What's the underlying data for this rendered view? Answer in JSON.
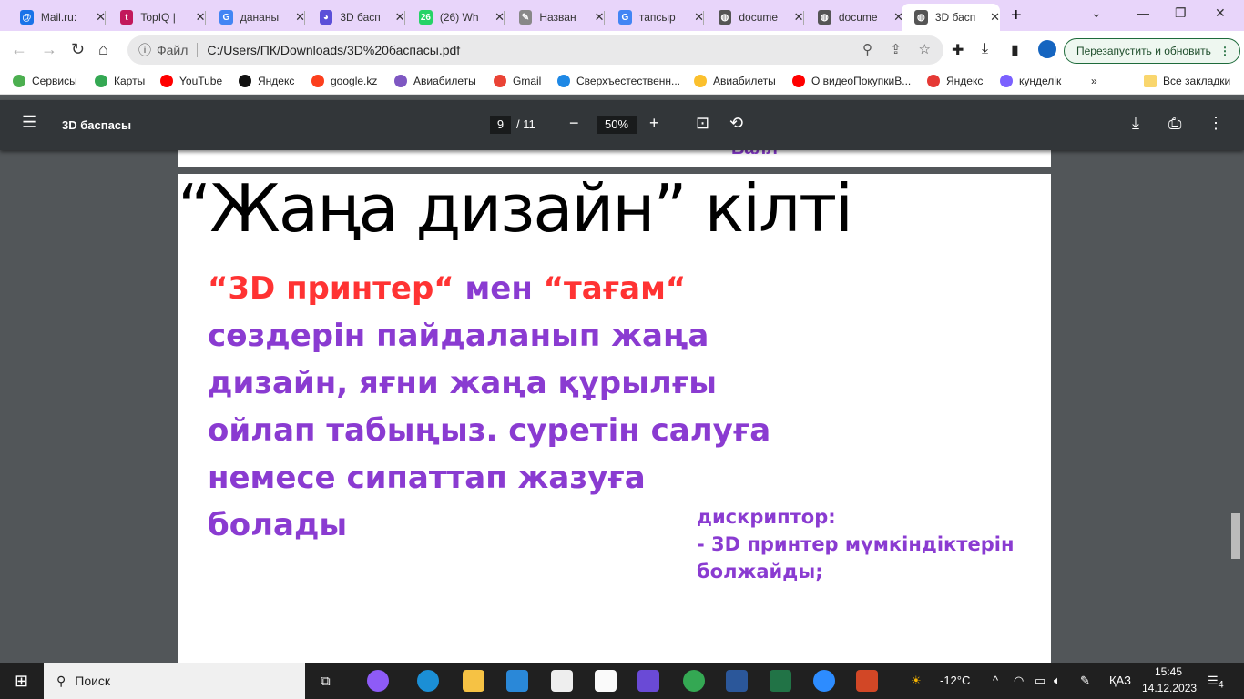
{
  "tabs": [
    {
      "label": "Mail.ru:",
      "color": "#1a73e8",
      "glyph": "@"
    },
    {
      "label": "TopIQ |",
      "color": "#c2185b",
      "glyph": "t"
    },
    {
      "label": "дананы",
      "color": "#4285f4",
      "glyph": "G"
    },
    {
      "label": "3D басп",
      "color": "#5b4fd8",
      "glyph": "◕"
    },
    {
      "label": "(26) Wh",
      "color": "#25d366",
      "glyph": "26"
    },
    {
      "label": "Назван",
      "color": "#888",
      "glyph": "✎"
    },
    {
      "label": "тапсыр",
      "color": "#4285f4",
      "glyph": "G"
    },
    {
      "label": "docume",
      "color": "#555",
      "glyph": "◍"
    },
    {
      "label": "docume",
      "color": "#555",
      "glyph": "◍"
    },
    {
      "label": "3D басп",
      "color": "#555",
      "glyph": "◍"
    }
  ],
  "address": {
    "scheme_label": "Файл",
    "url": "C:/Users/ПК/Downloads/3D%20баспасы.pdf"
  },
  "relaunch_label": "Перезапустить и обновить",
  "bookmarks": [
    {
      "label": "Сервисы",
      "color": "#4caf50"
    },
    {
      "label": "Карты",
      "color": "#34a853"
    },
    {
      "label": "YouTube",
      "color": "#ff0000"
    },
    {
      "label": "Яндекс",
      "color": "#111"
    },
    {
      "label": "google.kz",
      "color": "#fc3f1d"
    },
    {
      "label": "Авиабилеты",
      "color": "#7e57c2"
    },
    {
      "label": "Gmail",
      "color": "#ea4335"
    },
    {
      "label": "Сверхъестественн...",
      "color": "#1e88e5"
    },
    {
      "label": "Авиабилеты",
      "color": "#fbc02d"
    },
    {
      "label": "О видеоПокупкиВ...",
      "color": "#ff0000"
    },
    {
      "label": "Яндекс",
      "color": "#e53935"
    },
    {
      "label": "кунделік",
      "color": "#7b61ff"
    }
  ],
  "all_bookmarks": "Все закладки",
  "pdf": {
    "title": "3D баспасы",
    "page": "9",
    "total": "/ 11",
    "zoom": "50%"
  },
  "page_prev_fragment": "Балл",
  "slide": {
    "title": "“Жаңа дизайн” кілті",
    "q1": "“3D принтер“",
    "mid": " мен ",
    "q2": "“тағам“",
    "body": "сөздерін пайдаланып жаңа дизайн, яғни жаңа құрылғы ойлап табыңыз. суретін салуға немесе сипаттап жазуға болады",
    "desc_label": "дискриптор:",
    "desc_line": "- 3D принтер мүмкіндіктерін болжайды;"
  },
  "taskbar": {
    "search": "Поиск",
    "weather": "-12°C",
    "lang": "ҚАЗ",
    "time": "15:45",
    "date": "14.12.2023",
    "notif": "4"
  }
}
